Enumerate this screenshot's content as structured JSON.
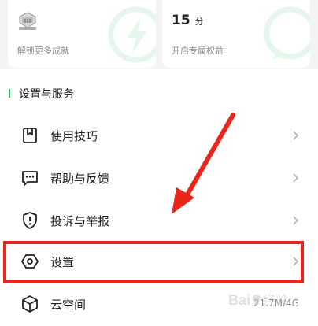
{
  "cards": [
    {
      "caption": "解锁更多成就",
      "icon": "medal-icon"
    },
    {
      "value": "15",
      "unit": "分",
      "caption": "开启专属权益",
      "icon": "lightning-icon"
    }
  ],
  "section": {
    "title": "设置与服务"
  },
  "menu": [
    {
      "label": "使用技巧",
      "icon": "bookmark-icon"
    },
    {
      "label": "帮助与反馈",
      "icon": "chat-bubble-icon"
    },
    {
      "label": "投诉与举报",
      "icon": "shield-alert-icon"
    },
    {
      "label": "设置",
      "icon": "gear-hexagon-icon"
    },
    {
      "label": "云空间",
      "icon": "cube-icon",
      "value": "21.7M/4G"
    }
  ],
  "watermark": {
    "text": "Bai 经验"
  },
  "colors": {
    "accent": "#22c15e",
    "annotation": "#e8261b"
  }
}
